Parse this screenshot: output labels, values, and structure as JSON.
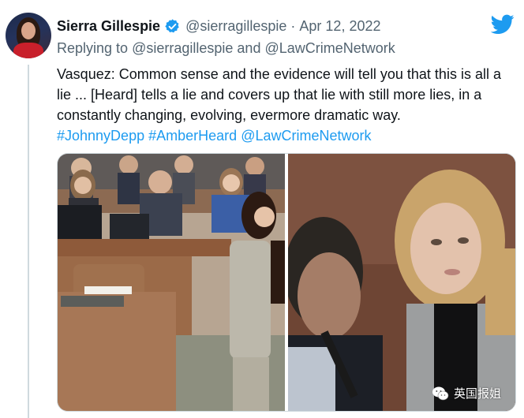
{
  "tweet": {
    "author_name": "Sierra Gillespie",
    "handle": "@sierragillespie",
    "separator": "·",
    "date": "Apr 12, 2022",
    "replying_prefix": "Replying to",
    "reply_mention_1": "@sierragillespie",
    "reply_and": "and",
    "reply_mention_2": "@LawCrimeNetwork",
    "text": "Vasquez: Common sense and the evidence will tell you that this is all a lie ... [Heard] tells a lie and covers up that lie with still more lies, in a constantly changing, evolving, evermore dramatic way.",
    "hashtag_1": "#JohnnyDepp",
    "hashtag_2": "#AmberHeard",
    "mention_end": "@LawCrimeNetwork"
  },
  "watermark": {
    "text": "英国报姐",
    "icon": "wechat-icon"
  },
  "icons": {
    "verified": "verified-badge-icon",
    "brand": "twitter-bird-icon"
  },
  "colors": {
    "link": "#1d9bf0",
    "secondary_text": "#536471",
    "verified": "#1d9bf0"
  }
}
